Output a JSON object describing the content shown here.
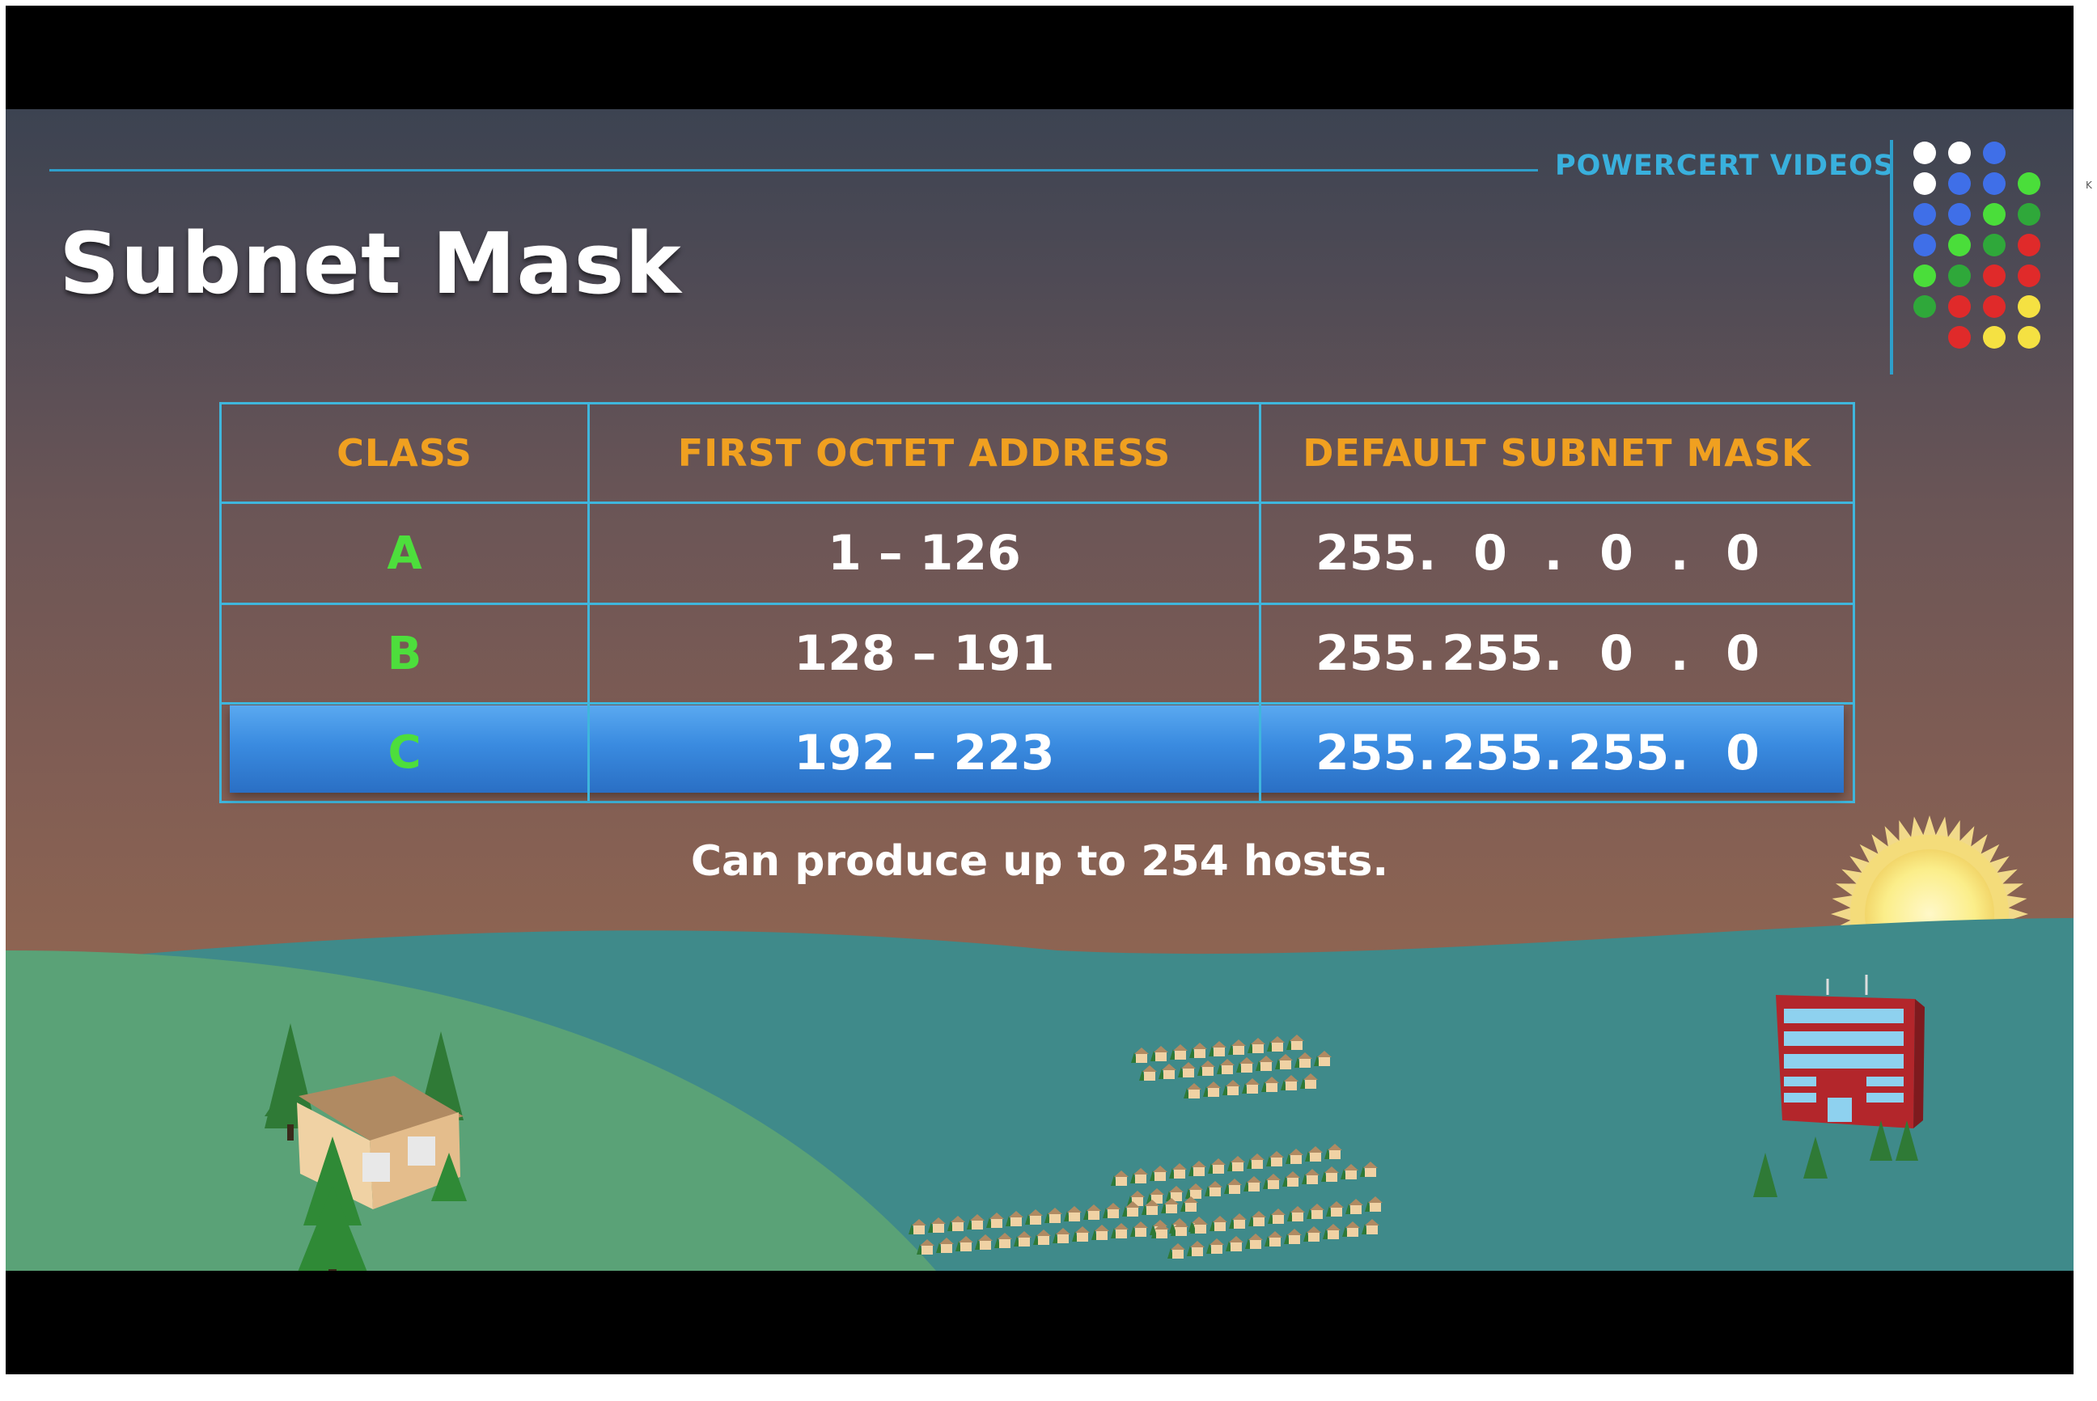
{
  "brand": {
    "name": "POWERCERT VIDEOS",
    "logo_colors": [
      "#ffffff",
      "#3f6fe8",
      "#4ade3a",
      "#2fa83a",
      "#e02a2a",
      "#f5e142"
    ]
  },
  "title": "Subnet Mask",
  "table": {
    "headers": [
      "CLASS",
      "FIRST OCTET ADDRESS",
      "DEFAULT SUBNET MASK"
    ],
    "rows": [
      {
        "class": "A",
        "range": "1 – 126",
        "mask": [
          "255",
          "0",
          "0",
          "0"
        ]
      },
      {
        "class": "B",
        "range": "128 – 191",
        "mask": [
          "255",
          "255",
          "0",
          "0"
        ]
      },
      {
        "class": "C",
        "range": "192 – 223",
        "mask": [
          "255",
          "255",
          "255",
          "0"
        ],
        "highlighted": true
      }
    ],
    "separator": "."
  },
  "caption": "Can produce up to 254 hosts.",
  "side_mark": "K",
  "colors": {
    "header_text": "#f0a020",
    "class_text": "#4dde3c",
    "table_border": "#3fb6dc",
    "highlight": "#3a8be0",
    "brand": "#39b0dd"
  },
  "illustration": {
    "elements": [
      "house-icon",
      "tree-icon",
      "office-building-icon",
      "sun-icon",
      "town-houses"
    ]
  }
}
